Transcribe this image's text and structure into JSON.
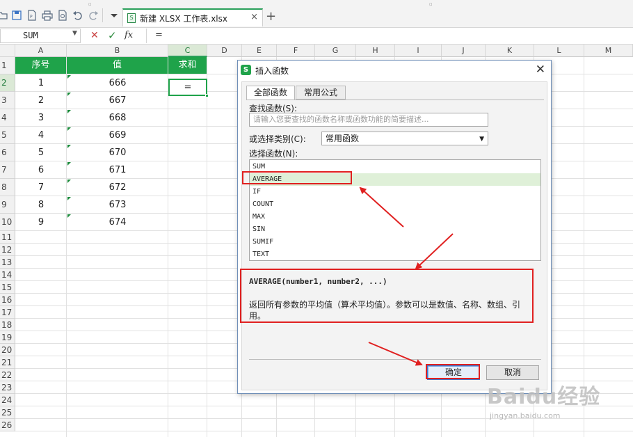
{
  "toolbar": {
    "icons": [
      "open-folder-icon",
      "save-icon",
      "export-pdf-icon",
      "print-icon",
      "print-preview-icon",
      "undo-icon",
      "redo-icon",
      "customize-dropdown-icon"
    ],
    "tab": {
      "title": "新建 XLSX 工作表.xlsx",
      "close": "×",
      "add": "+"
    }
  },
  "formula_bar": {
    "name_box": "SUM",
    "cancel": "✕",
    "enter": "✓",
    "fx": "fx",
    "value": "="
  },
  "sheet": {
    "columns": [
      "A",
      "B",
      "C",
      "D",
      "E",
      "F",
      "G",
      "H",
      "I",
      "J",
      "K",
      "L",
      "M"
    ],
    "active_column": "C",
    "active_row": "2",
    "row_numbers": [
      "1",
      "2",
      "3",
      "4",
      "5",
      "6",
      "7",
      "8",
      "9",
      "10",
      "11",
      "12",
      "13",
      "14",
      "15",
      "16",
      "17",
      "18",
      "19",
      "20",
      "21",
      "22",
      "23",
      "24",
      "25",
      "26"
    ],
    "headers": {
      "a": "序号",
      "b": "值",
      "c": "求和"
    },
    "rows": [
      {
        "a": "1",
        "b": "666"
      },
      {
        "a": "2",
        "b": "667"
      },
      {
        "a": "3",
        "b": "668"
      },
      {
        "a": "4",
        "b": "669"
      },
      {
        "a": "5",
        "b": "670"
      },
      {
        "a": "6",
        "b": "671"
      },
      {
        "a": "7",
        "b": "672"
      },
      {
        "a": "8",
        "b": "673"
      },
      {
        "a": "9",
        "b": "674"
      }
    ],
    "active_cell_value": "="
  },
  "dialog": {
    "title": "插入函数",
    "logo": "S",
    "close": "✕",
    "tabs": [
      "全部函数",
      "常用公式"
    ],
    "search_label": "查找函数(S):",
    "search_placeholder": "请输入您要查找的函数名称或函数功能的简要描述...",
    "category_label": "或选择类别(C):",
    "category_value": "常用函数",
    "list_label": "选择函数(N):",
    "functions": [
      "SUM",
      "AVERAGE",
      "IF",
      "COUNT",
      "MAX",
      "SIN",
      "SUMIF",
      "TEXT"
    ],
    "selected_function": "AVERAGE",
    "signature": "AVERAGE(number1, number2, ...)",
    "description": "返回所有参数的平均值（算术平均值）。参数可以是数值、名称、数组、引用。",
    "ok": "确定",
    "cancel": "取消"
  },
  "watermark": {
    "brand": "Baidu经验",
    "url": "jingyan.baidu.com"
  },
  "colors": {
    "accent_green": "#1fa34a",
    "annotation_red": "#e02020",
    "dialog_border": "#6f8fb8"
  }
}
